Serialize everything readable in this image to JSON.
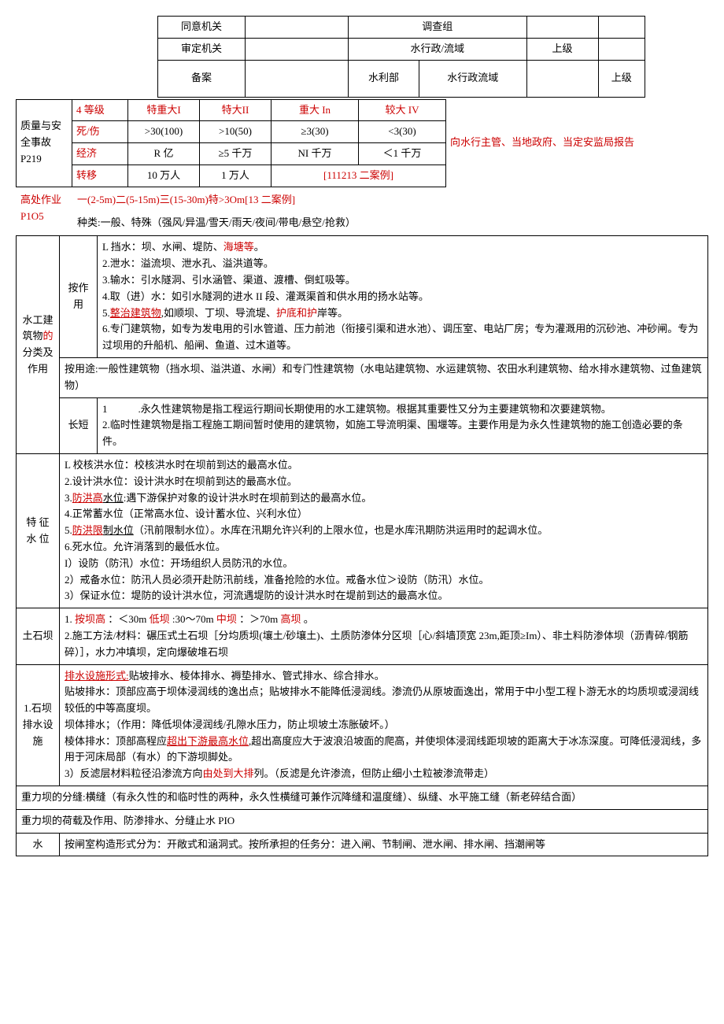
{
  "tbl1": {
    "r1c1": "同意机关",
    "r1c3": "调查组",
    "r2c1": "审定机关",
    "r2c3": "水行政/流域",
    "r2c4": "上级",
    "r3c1": "备案",
    "r3c3": "水利部",
    "r3c4": "水行政流域",
    "r3c6": "上级"
  },
  "tbl2": {
    "side": "质量与安全事故 P219",
    "h1": "4 等级",
    "c11": "特重大I",
    "c12": "特大II",
    "c13": "重大 In",
    "c14": "较大 IV",
    "h2": "死/伤",
    "c21": ">30(100)",
    "c22": ">10(50)",
    "c23": "≥3(30)",
    "c24": "<3(30)",
    "h3": "经济",
    "c31": "R 亿",
    "c32": "≥5 千万",
    "c33": "NI 千万",
    "c34": "＜1 千万",
    "h4": "转移",
    "c41": "10 万人",
    "c42": "1 万人",
    "c43": "[111213 二案例]",
    "note": "向水行主管、当地政府、当定安监局报告"
  },
  "gao": {
    "label": "高处作业",
    "ref": "P1O5",
    "line1a": "一(2-5m)二(5-15m)三(15-30m)特>3Om[13 二案例]",
    "line2": "种类:一般、特殊（强风/异温/雪天/雨天/夜间/带电/悬空/抢救）"
  },
  "sg": {
    "side": "水工建筑物",
    "side2": "的",
    "side3": "分类及作用",
    "by": "按作用",
    "l1": "L 挡水：坝、水闸、堤防、",
    "l1b": "海塘等",
    "l1c": "。",
    "l2": "2.泄水：溢流坝、泄水孔、溢洪道等。",
    "l3": "3.输水：引水隧洞、引水涵管、渠道、渡槽、倒虹吸等。",
    "l4": "4.取（进）水：如引水隧洞的进水 II 段、灌溉渠首和供水用的扬水站等。",
    "l5a": "5.",
    "l5b": "整治建筑物",
    "l5c": ",如顺坝、丁坝、导流堤、",
    "l5d": "护底和护",
    "l5e": "岸等。",
    "l6": "6.专门建筑物，如专为发电用的引水管道、压力前池（衔接引渠和进水池）、调压室、电站厂房；专为灌溉用的沉砂池、冲砂闸。专为过坝用的升船机、船闸、鱼道、过木道等。",
    "yt": "按用途:一般性建筑物（挡水坝、溢洪道、水闸）和专门性建筑物（水电站建筑物、水运建筑物、农田水利建筑物、给水排水建筑物、过鱼建筑物）",
    "cd_label": "长短",
    "cd1": "1   .永久性建筑物是指工程运行期间长期使用的水工建筑物。根据其重要性又分为主要建筑物和次要建筑物。",
    "cd2": "2.临时性建筑物是指工程施工期间暂时使用的建筑物，如施工导流明渠、围堰等。主要作用是为永久性建筑物的施工创造必要的条件。"
  },
  "tz": {
    "side": "特 征水 位",
    "l1": "L 校核洪水位：校核洪水时在坝前到达的最高水位。",
    "l2": "2.设计洪水位：设计洪水时在坝前到达的最高水位。",
    "l3a": "3.",
    "l3b": "防洪高",
    "l3c": "水位",
    "l3d": ":遇下游保护对象的设计洪水时在坝前到达的最高水位。",
    "l4": "4.正常蓄水位（正常高水位、设计蓄水位、兴利水位）",
    "l5a": "5.",
    "l5b": "防洪限",
    "l5c": "制水位",
    "l5d": "（汛前限制水位）。水库在汛期允许兴利的上限水位，也是水库汛期防洪运用时的起调水位。",
    "l6": "6.死水位。允许消落到的最低水位。",
    "l7": "I）设防（防汛）水位：开场组织人员防汛的水位。",
    "l8": "2）戒备水位：防汛人员必须开赴防汛前线，准备抢险的水位。戒备水位＞设防（防汛）水位。",
    "l9": "3）保证水位：堤防的设计洪水位，河流遇堤防的设计洪水时在堤前到达的最高水位。"
  },
  "ts": {
    "side": "土石坝",
    "l1a": "1.",
    "l1b": "按坝高",
    "l1c": "：＜30m",
    "l1d": "低坝",
    "l1e": ":30～70m",
    "l1f": "中坝",
    "l1g": "：＞70m",
    "l1h": "高坝",
    "l1i": "。",
    "l2": "2.施工方法/材料：碾压式土石坝［分均质坝(壤土/砂壤土)、土质防渗体分区坝［心/斜墙顶宽 23m,距顶≥Im）、非土料防渗体坝（沥青碎/钢筋碎）］，水力冲填坝，定向爆破堆石坝"
  },
  "ps": {
    "side": "1.石坝排水设施",
    "l0a": "排水设施形式:",
    "l0b": "贴坡排水、棱体排水、褥垫排水、管式排水、综合排水。",
    "l1": "贴坡排水：顶部应高于坝体浸润线的逸出点；贴坡排水不能降低浸润线。渗流仍从原坡面逸出，常用于中小型工程卜游无水的均质坝或浸润线较低的中等高度坝。",
    "l2": "坝体排水；（作用：降低坝体浸润线/孔隙水压力，防止坝坡土冻胀破坏。）",
    "l3a": "棱体排水：顶部高程应",
    "l3b": "超出下游最高水位",
    "l3c": ",超出高度应大于波浪沿坡面的爬高，并使坝体浸润线距坝坡的距离大于冰冻深度。可降低浸润线，多用于河床局部（有水）的下游坝脚处。",
    "l4a": "3）反滤层材料粒径沿渗流方向",
    "l4b": "由处到大排",
    "l4c": "列。（反滤是允许渗流，但防止细小土粒被渗流带走）"
  },
  "zl1": "重力坝的分缝:横缝（有永久性的和临时性的两种，永久性横缝可兼作沉降缝和温度缝）、纵缝、水平施工缝（新老碎结合面）",
  "zl2": "重力坝的荷载及作用、防渗排水、分缝止水 PIO",
  "sz": {
    "side": "水",
    "txt": "按闸室构造形式分为：开敞式和涵洞式。按所承担的任务分：进入闸、节制闸、泄水闸、排水闸、挡潮闸等"
  }
}
